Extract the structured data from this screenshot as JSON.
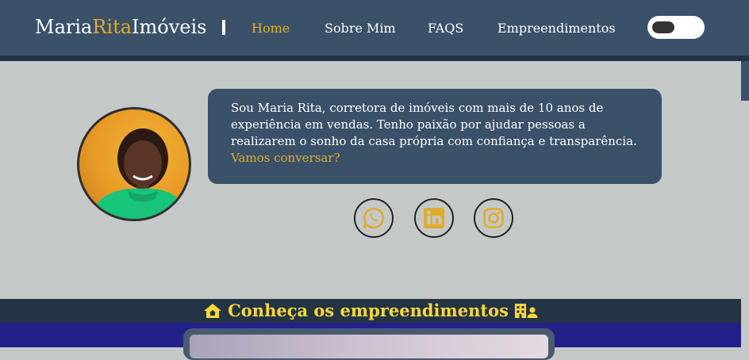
{
  "header": {
    "brand": {
      "part1": "Maria",
      "part2": "Rita",
      "part3": "Imóveis"
    },
    "nav": [
      {
        "label": "Home",
        "active": true
      },
      {
        "label": "Sobre Mim",
        "active": false
      },
      {
        "label": "FAQS",
        "active": false
      },
      {
        "label": "Empreendimentos",
        "active": false
      }
    ],
    "theme_toggle": {
      "state": "off"
    }
  },
  "hero": {
    "avatar_alt": "Maria Rita",
    "bio": "Sou Maria Rita, corretora de imóveis com mais de 10 anos de experiência em vendas. Tenho paixão por ajudar pessoas a realizarem o sonho da casa própria com confiança e transparência.",
    "cta": "Vamos conversar?",
    "social": [
      {
        "icon": "whatsapp-icon"
      },
      {
        "icon": "linkedin-icon"
      },
      {
        "icon": "instagram-icon"
      }
    ]
  },
  "section": {
    "title": "Conheça os empreendimentos",
    "icons": [
      "home-icon",
      "building-user-icon"
    ]
  },
  "colors": {
    "header_bg": "#3a5169",
    "accent_gold": "#e0ac2c",
    "page_bg": "#c4c9c8",
    "section_title": "#ffd83a",
    "section_bg": "#24208a"
  }
}
